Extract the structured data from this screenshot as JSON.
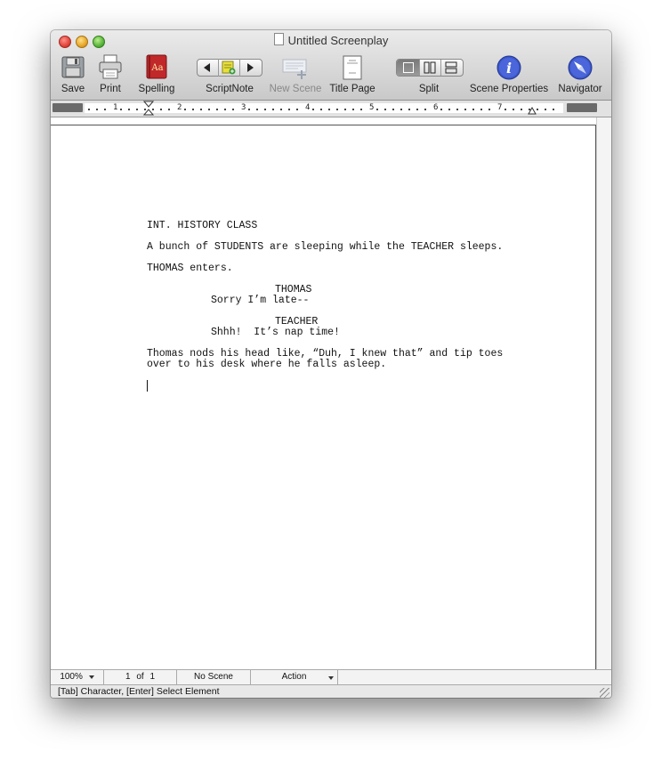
{
  "window": {
    "title": "Untitled Screenplay"
  },
  "toolbar": {
    "save": "Save",
    "print": "Print",
    "spelling": "Spelling",
    "scriptnote": "ScriptNote",
    "new_scene": "New Scene",
    "title_page": "Title Page",
    "split": "Split",
    "scene_properties": "Scene Properties",
    "navigator": "Navigator",
    "spelling_glyph": "Aa"
  },
  "ruler": {
    "numbers": [
      "1",
      "2",
      "3",
      "4",
      "5",
      "6",
      "7"
    ]
  },
  "script": {
    "scene_heading": "INT. HISTORY CLASS",
    "action1": "A bunch of STUDENTS are sleeping while the TEACHER sleeps.",
    "action2": "THOMAS enters.",
    "char1": "THOMAS",
    "dialogue1": "Sorry I’m late--",
    "char2": "TEACHER",
    "dialogue2": "Shhh!  It’s nap time!",
    "action3_line1": "Thomas nods his head like, “Duh, I knew that” and tip toes",
    "action3_line2": "over to his desk where he falls asleep."
  },
  "status": {
    "zoom": "100%",
    "page_num": "1",
    "page_of": "of",
    "page_total": "1",
    "scene": "No Scene",
    "element": "Action"
  },
  "hint": "[Tab]  Character,  [Enter] Select Element",
  "icons": {
    "save": "floppy-disk-icon",
    "print": "printer-icon",
    "spelling": "dictionary-book-icon",
    "scriptnote": "sticky-note-icon",
    "new_scene": "add-scene-icon",
    "title_page": "page-icon",
    "scene_properties": "info-icon",
    "navigator": "compass-icon"
  },
  "colors": {
    "info_blue": "#3b57c9",
    "spelling_red": "#c0282a",
    "note_yellow": "#e8e03a"
  }
}
